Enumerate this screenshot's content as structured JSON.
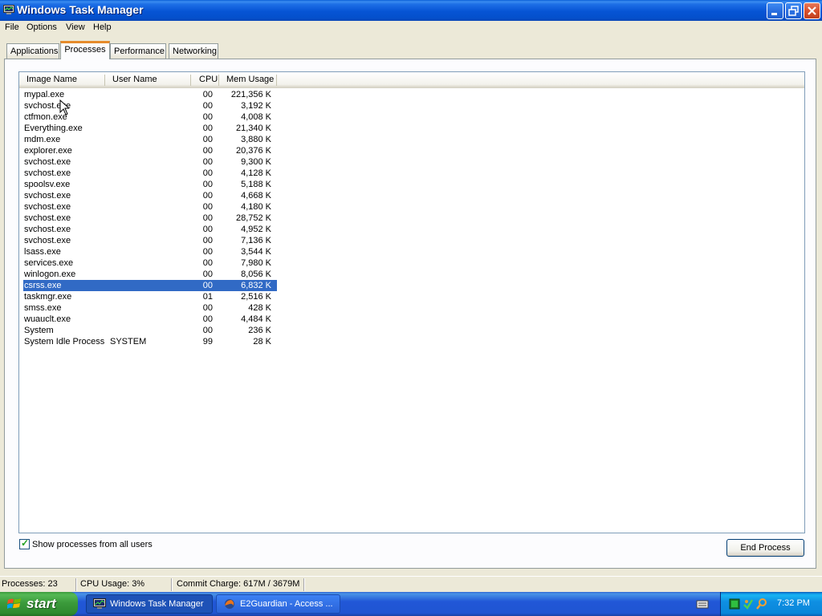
{
  "window": {
    "title": "Windows Task Manager"
  },
  "menu": [
    "File",
    "Options",
    "View",
    "Help"
  ],
  "tabs": [
    "Applications",
    "Processes",
    "Performance",
    "Networking"
  ],
  "active_tab": "Processes",
  "columns": {
    "image_name": "Image Name",
    "user_name": "User Name",
    "cpu": "CPU",
    "mem_usage": "Mem Usage"
  },
  "processes": [
    {
      "name": "mypal.exe",
      "user": "",
      "cpu": "00",
      "mem": "221,356 K"
    },
    {
      "name": "svchost.exe",
      "user": "",
      "cpu": "00",
      "mem": "3,192 K"
    },
    {
      "name": "ctfmon.exe",
      "user": "",
      "cpu": "00",
      "mem": "4,008 K"
    },
    {
      "name": "Everything.exe",
      "user": "",
      "cpu": "00",
      "mem": "21,340 K"
    },
    {
      "name": "mdm.exe",
      "user": "",
      "cpu": "00",
      "mem": "3,880 K"
    },
    {
      "name": "explorer.exe",
      "user": "",
      "cpu": "00",
      "mem": "20,376 K"
    },
    {
      "name": "svchost.exe",
      "user": "",
      "cpu": "00",
      "mem": "9,300 K"
    },
    {
      "name": "svchost.exe",
      "user": "",
      "cpu": "00",
      "mem": "4,128 K"
    },
    {
      "name": "spoolsv.exe",
      "user": "",
      "cpu": "00",
      "mem": "5,188 K"
    },
    {
      "name": "svchost.exe",
      "user": "",
      "cpu": "00",
      "mem": "4,668 K"
    },
    {
      "name": "svchost.exe",
      "user": "",
      "cpu": "00",
      "mem": "4,180 K"
    },
    {
      "name": "svchost.exe",
      "user": "",
      "cpu": "00",
      "mem": "28,752 K"
    },
    {
      "name": "svchost.exe",
      "user": "",
      "cpu": "00",
      "mem": "4,952 K"
    },
    {
      "name": "svchost.exe",
      "user": "",
      "cpu": "00",
      "mem": "7,136 K"
    },
    {
      "name": "lsass.exe",
      "user": "",
      "cpu": "00",
      "mem": "3,544 K"
    },
    {
      "name": "services.exe",
      "user": "",
      "cpu": "00",
      "mem": "7,980 K"
    },
    {
      "name": "winlogon.exe",
      "user": "",
      "cpu": "00",
      "mem": "8,056 K"
    },
    {
      "name": "csrss.exe",
      "user": "",
      "cpu": "00",
      "mem": "6,832 K",
      "selected": true
    },
    {
      "name": "taskmgr.exe",
      "user": "",
      "cpu": "01",
      "mem": "2,516 K"
    },
    {
      "name": "smss.exe",
      "user": "",
      "cpu": "00",
      "mem": "428 K"
    },
    {
      "name": "wuauclt.exe",
      "user": "",
      "cpu": "00",
      "mem": "4,484 K"
    },
    {
      "name": "System",
      "user": "",
      "cpu": "00",
      "mem": "236 K"
    },
    {
      "name": "System Idle Process",
      "user": "SYSTEM",
      "cpu": "99",
      "mem": "28 K"
    }
  ],
  "show_all_users": {
    "label": "Show processes from all users",
    "checked": true
  },
  "end_process_label": "End Process",
  "status": {
    "processes": "Processes: 23",
    "cpu_usage": "CPU Usage: 3%",
    "commit_charge": "Commit Charge: 617M / 3679M"
  },
  "taskbar": {
    "start_label": "start",
    "tasks": [
      {
        "label": "Windows Task Manager",
        "icon": "task-manager-icon",
        "active": true
      },
      {
        "label": "E2Guardian - Access ...",
        "icon": "firefox-icon",
        "active": false
      }
    ],
    "clock": "7:32 PM"
  },
  "colors": {
    "selection": "#316ac5",
    "titlebar": "#0654d4",
    "taskbar": "#2157d7",
    "start": "#3b9a3b",
    "tray": "#0f8fe2"
  }
}
